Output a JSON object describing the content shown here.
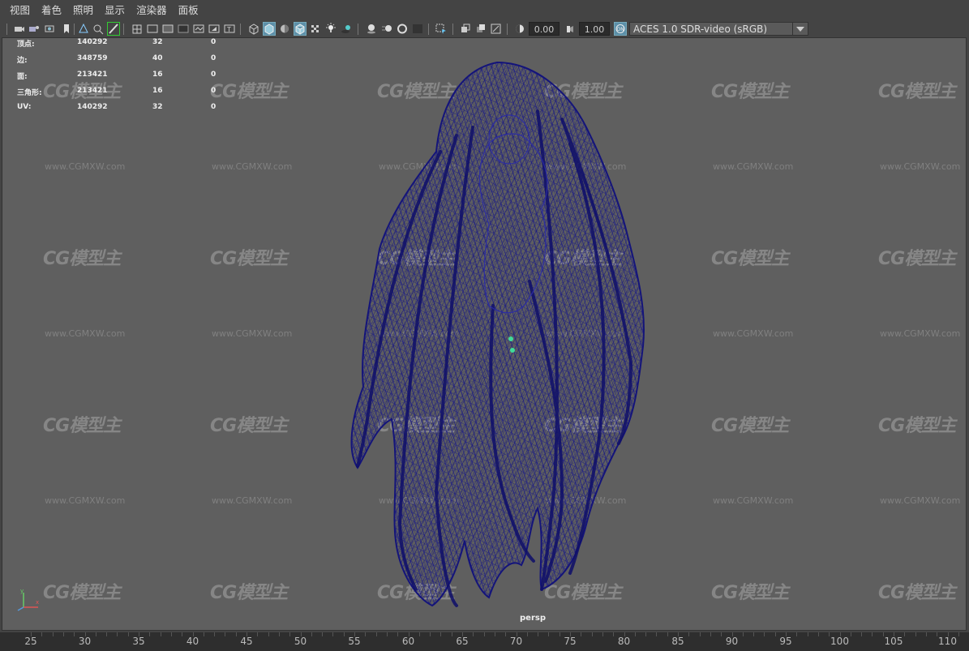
{
  "menu": [
    "视图",
    "着色",
    "照明",
    "显示",
    "渲染器",
    "面板"
  ],
  "toolbar": {
    "exposure_value": "0.00",
    "gamma_value": "1.00",
    "color_space": "ACES 1.0 SDR-video (sRGB)"
  },
  "hud": {
    "rows": [
      {
        "label": "顶点:",
        "v1": "140292",
        "v2": "32",
        "v3": "0"
      },
      {
        "label": "边:",
        "v1": "348759",
        "v2": "40",
        "v3": "0"
      },
      {
        "label": "面:",
        "v1": "213421",
        "v2": "16",
        "v3": "0"
      },
      {
        "label": "三角形:",
        "v1": "213421",
        "v2": "16",
        "v3": "0"
      },
      {
        "label": "UV:",
        "v1": "140292",
        "v2": "32",
        "v3": "0"
      }
    ]
  },
  "viewport": {
    "camera": "persp",
    "watermark_logo": "CG模型主",
    "watermark_url": "www.CGMXW.com",
    "wire_color": "#1a1a8c",
    "bg_color": "#5f5f5f"
  },
  "timeline": {
    "ticks": [
      "25",
      "30",
      "35",
      "40",
      "45",
      "50",
      "55",
      "60",
      "65",
      "70",
      "75",
      "80",
      "85",
      "90",
      "95",
      "100",
      "105",
      "110"
    ]
  }
}
